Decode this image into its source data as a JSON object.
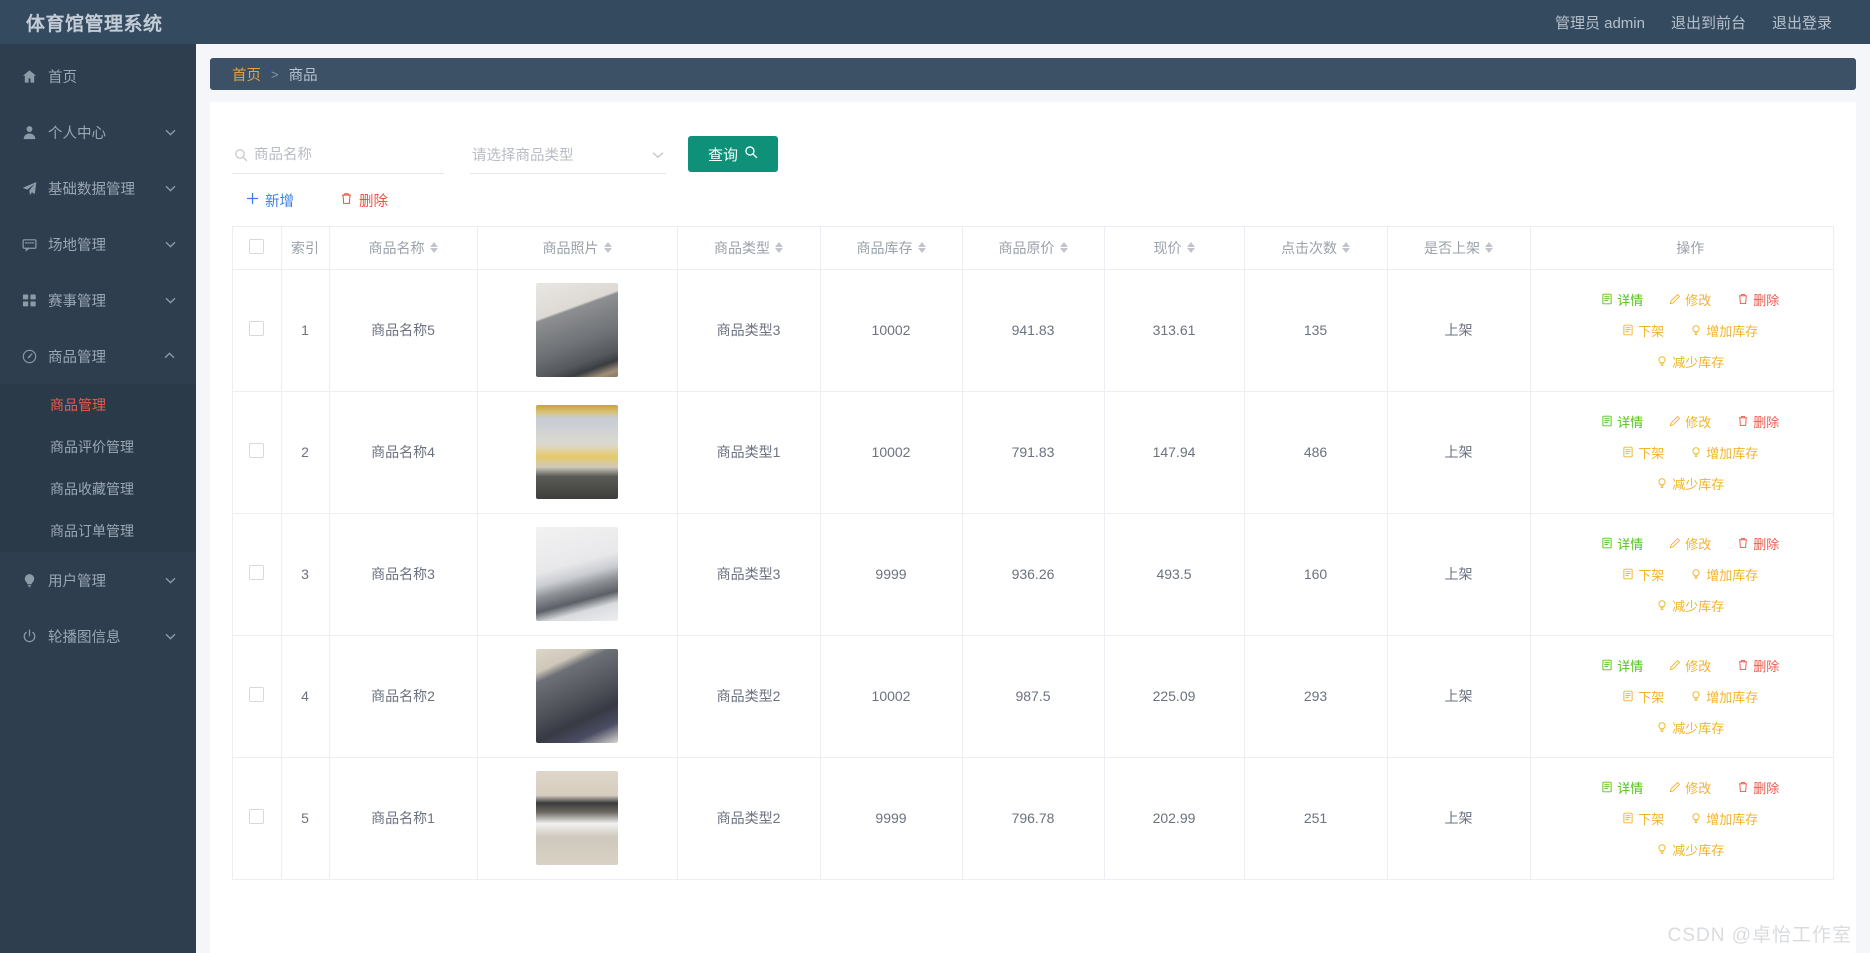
{
  "header": {
    "title": "体育馆管理系统",
    "nav": [
      {
        "label": "管理员 admin",
        "name": "admin-user"
      },
      {
        "label": "退出到前台",
        "name": "exit-to-front"
      },
      {
        "label": "退出登录",
        "name": "logout"
      }
    ]
  },
  "sidebar": {
    "items": [
      {
        "label": "首页",
        "icon": "home-icon",
        "expandable": false
      },
      {
        "label": "个人中心",
        "icon": "user-icon",
        "expandable": true,
        "open": false
      },
      {
        "label": "基础数据管理",
        "icon": "send-icon",
        "expandable": true,
        "open": false
      },
      {
        "label": "场地管理",
        "icon": "message-icon",
        "expandable": true,
        "open": false
      },
      {
        "label": "赛事管理",
        "icon": "grid-icon",
        "expandable": true,
        "open": false
      },
      {
        "label": "商品管理",
        "icon": "gauge-icon",
        "expandable": true,
        "open": true
      },
      {
        "label": "用户管理",
        "icon": "bulb-icon",
        "expandable": true,
        "open": false
      },
      {
        "label": "轮播图信息",
        "icon": "power-icon",
        "expandable": true,
        "open": false
      }
    ],
    "submenu": [
      {
        "label": "商品管理",
        "active": true
      },
      {
        "label": "商品评价管理",
        "active": false
      },
      {
        "label": "商品收藏管理",
        "active": false
      },
      {
        "label": "商品订单管理",
        "active": false
      }
    ]
  },
  "breadcrumb": {
    "home": "首页",
    "separator": ">",
    "current": "商品"
  },
  "filter": {
    "search_placeholder": "商品名称",
    "search_value": "",
    "search_icon": "search-icon",
    "type_select_value": "请选择商品类型",
    "query_button": "查询",
    "query_icon": "search-icon"
  },
  "actions": {
    "add_label": "新增",
    "add_icon": "plus-icon",
    "delete_label": "删除",
    "delete_icon": "trash-icon"
  },
  "table": {
    "columns": [
      {
        "label": "",
        "sortable": false,
        "name": "select-all"
      },
      {
        "label": "索引",
        "sortable": false
      },
      {
        "label": "商品名称",
        "sortable": true
      },
      {
        "label": "商品照片",
        "sortable": true
      },
      {
        "label": "商品类型",
        "sortable": true
      },
      {
        "label": "商品库存",
        "sortable": true
      },
      {
        "label": "商品原价",
        "sortable": true
      },
      {
        "label": "现价",
        "sortable": true
      },
      {
        "label": "点击次数",
        "sortable": true
      },
      {
        "label": "是否上架",
        "sortable": true
      },
      {
        "label": "操作",
        "sortable": false
      }
    ],
    "op_labels": {
      "detail": "详情",
      "edit": "修改",
      "delete": "删除",
      "shelf": "下架",
      "increase": "增加库存",
      "decrease": "减少库存"
    },
    "rows": [
      {
        "index": "1",
        "name": "商品名称5",
        "type": "商品类型3",
        "stock": "10002",
        "price": "941.83",
        "current": "313.61",
        "clicks": "135",
        "shelf": "上架",
        "thumb": "laptop-back"
      },
      {
        "index": "2",
        "name": "商品名称4",
        "type": "商品类型1",
        "stock": "10002",
        "price": "791.83",
        "current": "147.94",
        "clicks": "486",
        "shelf": "上架",
        "thumb": "gold-mirror"
      },
      {
        "index": "3",
        "name": "商品名称3",
        "type": "商品类型3",
        "stock": "9999",
        "price": "936.26",
        "current": "493.5",
        "clicks": "160",
        "shelf": "上架",
        "thumb": "laptop-open"
      },
      {
        "index": "4",
        "name": "商品名称2",
        "type": "商品类型2",
        "stock": "10002",
        "price": "987.5",
        "current": "225.09",
        "clicks": "293",
        "shelf": "上架",
        "thumb": "laptop-tilt"
      },
      {
        "index": "5",
        "name": "商品名称1",
        "type": "商品类型2",
        "stock": "9999",
        "price": "796.78",
        "current": "202.99",
        "clicks": "251",
        "shelf": "上架",
        "thumb": "shelf-rack"
      }
    ]
  },
  "watermark": "CSDN @卓怡工作室",
  "colors": {
    "topbar": "#344a5f",
    "sidebar": "#2e3e4e",
    "submenu": "#2b3a49",
    "active_red": "#f0584b",
    "breadcrumb_bg": "#3c5066",
    "breadcrumb_home": "#e6a23c",
    "primary_green": "#0e9178",
    "link_blue": "#3c7fe8",
    "warn_orange": "#f0b429",
    "success_green": "#52c41a"
  }
}
